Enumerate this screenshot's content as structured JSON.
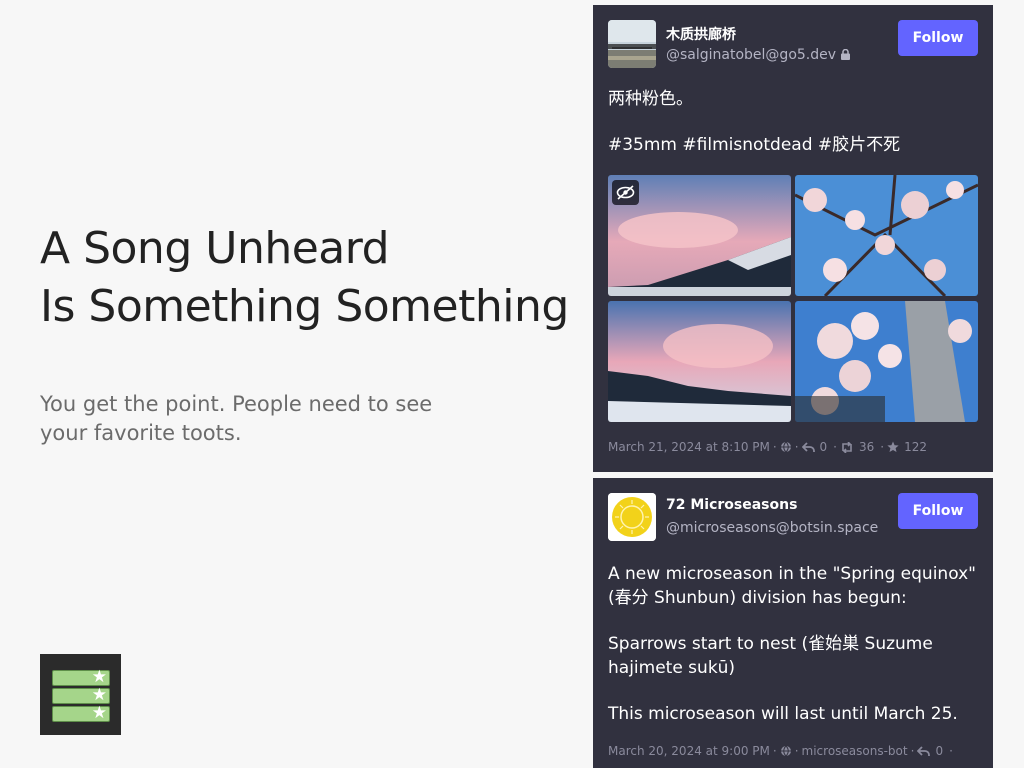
{
  "hero": {
    "title_line1": "A Song Unheard",
    "title_line2": "Is Something Something",
    "subtitle": "You get the point. People need to see your favorite toots."
  },
  "posts": [
    {
      "display_name": "木质拱廊桥",
      "handle": "@salginatobel@go5.dev",
      "follow_label": "Follow",
      "paragraphs": [
        "两种粉色。",
        "#35mm #filmisnotdead #胶片不死"
      ],
      "timestamp": "March 21, 2024 at 8:10 PM",
      "replies": "0",
      "boosts": "36",
      "favourites": "122"
    },
    {
      "display_name": "72 Microseasons",
      "handle": "@microseasons@botsin.space",
      "follow_label": "Follow",
      "paragraphs": [
        "A new microseason in the \"Spring equinox\" (春分 Shunbun) division has begun:",
        "Sparrows start to nest (雀始巣 Suzume hajimete sukū)",
        "This microseason will last until March 25."
      ],
      "timestamp": "March 20, 2024 at 9:00 PM",
      "app": "microseasons-bot",
      "replies": "0"
    }
  ],
  "colors": {
    "background": "#f7f7f7",
    "card": "#31313f",
    "accent": "#6364ff"
  },
  "icons": [
    "globe-icon",
    "reply-icon",
    "boost-icon",
    "star-icon",
    "lock-icon",
    "eye-slash-icon"
  ]
}
